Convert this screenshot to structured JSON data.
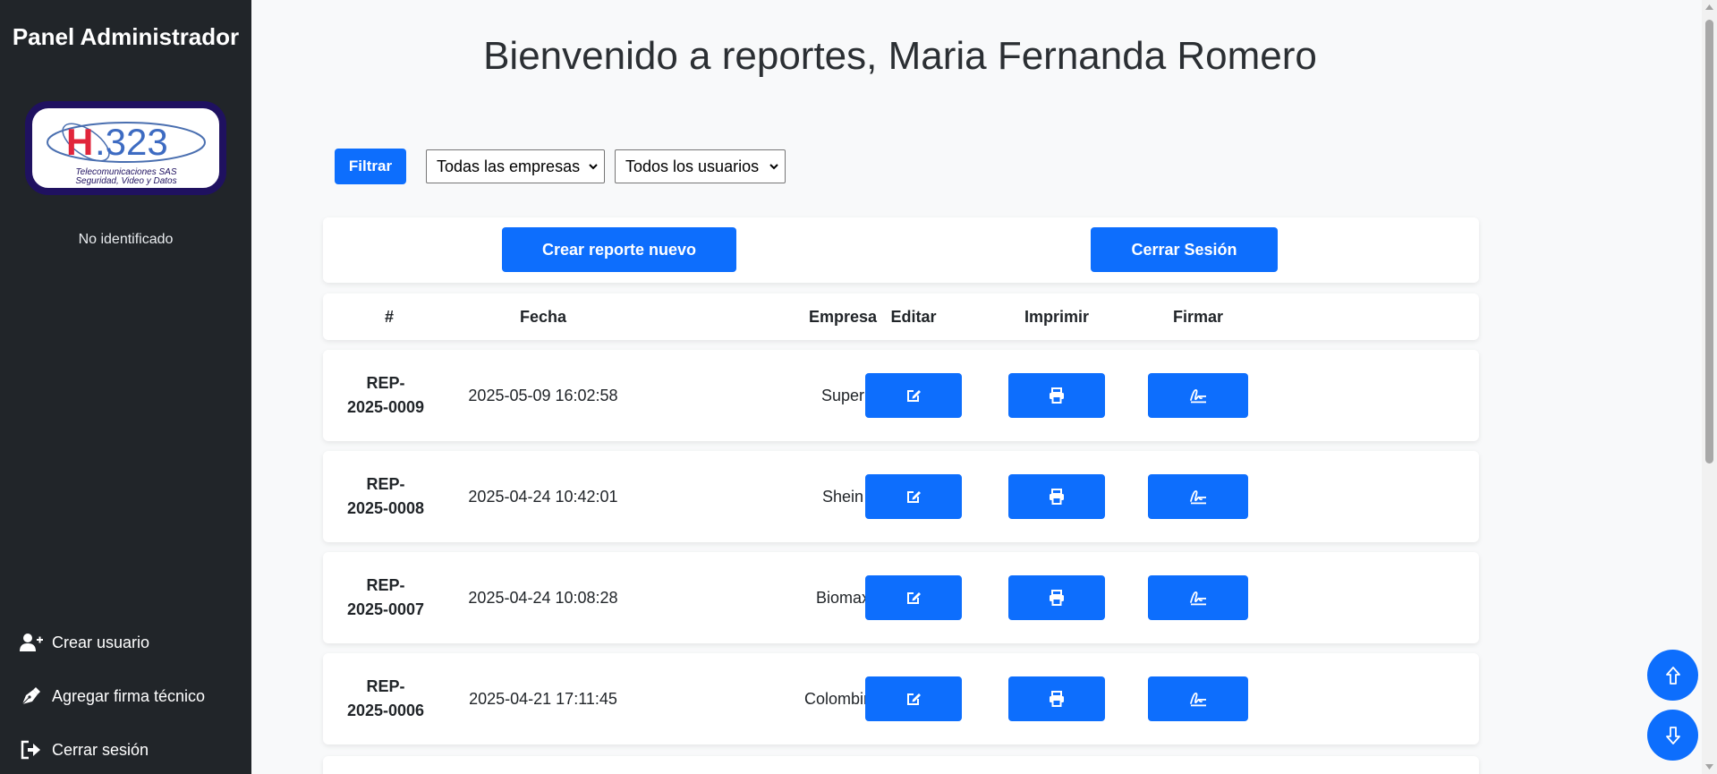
{
  "sidebar": {
    "title": "Panel Administrador",
    "logo": {
      "brand": "H.323",
      "line1": "Telecomunicaciones SAS",
      "line2": "Seguridad, Video y Datos"
    },
    "user_status": "No identificado",
    "nav": [
      {
        "label": "Crear usuario",
        "icon": "user-plus-icon"
      },
      {
        "label": "Agregar firma técnico",
        "icon": "pen-nib-icon"
      },
      {
        "label": "Cerrar sesión",
        "icon": "sign-out-icon"
      }
    ]
  },
  "header": {
    "title": "Bienvenido a reportes, Maria Fernanda Romero"
  },
  "filters": {
    "button_label": "Filtrar",
    "company_select": "Todas las empresas",
    "user_select": "Todos los usuarios"
  },
  "actions": {
    "new_report": "Crear reporte nuevo",
    "logout": "Cerrar Sesión"
  },
  "table": {
    "columns": [
      "#",
      "Fecha",
      "Empresa",
      "Editar",
      "Imprimir",
      "Firmar"
    ],
    "rows": [
      {
        "id_line1": "REP-",
        "id_line2": "2025-0009",
        "date": "2025-05-09 16:02:58",
        "company": "Super"
      },
      {
        "id_line1": "REP-",
        "id_line2": "2025-0008",
        "date": "2025-04-24 10:42:01",
        "company": "Shein"
      },
      {
        "id_line1": "REP-",
        "id_line2": "2025-0007",
        "date": "2025-04-24 10:08:28",
        "company": "Biomax"
      },
      {
        "id_line1": "REP-",
        "id_line2": "2025-0006",
        "date": "2025-04-21 17:11:45",
        "company": "Colombina"
      }
    ]
  },
  "colors": {
    "sidebar_bg": "#212529",
    "primary": "#0d6efd",
    "page_bg": "#f8f9fa"
  }
}
